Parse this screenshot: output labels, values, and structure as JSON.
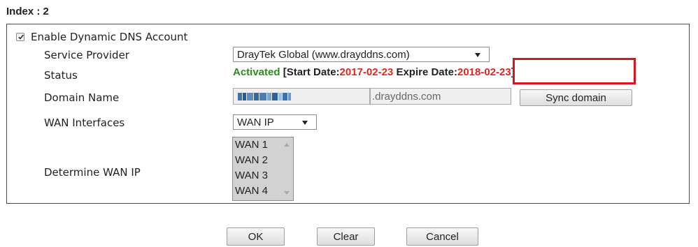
{
  "index_title": "Index : 2",
  "enable": {
    "label": "Enable Dynamic DNS Account",
    "checked": true
  },
  "service_provider": {
    "label": "Service Provider",
    "value": "DrayTek Global (www.drayddns.com)"
  },
  "status": {
    "label": "Status",
    "activated": "Activated",
    "start_prefix": " [Start Date:",
    "start_date": "2017-02-23",
    "expire_prefix": " Expire Date:",
    "expire_date": "2018-02-23",
    "close": "]"
  },
  "domain_name": {
    "label": "Domain Name",
    "suffix_value": ".drayddns.com",
    "sync_button": "Sync domain"
  },
  "wan_interfaces": {
    "label": "WAN Interfaces",
    "value": "WAN IP"
  },
  "determine_wan_ip": {
    "label": "Determine WAN IP",
    "options": [
      "WAN 1",
      "WAN 2",
      "WAN 3",
      "WAN 4"
    ]
  },
  "buttons": {
    "ok": "OK",
    "clear": "Clear",
    "cancel": "Cancel"
  },
  "colors": {
    "activated_green": "#2e8b1e",
    "date_red": "#e1261c",
    "highlight_red": "#d8141e"
  }
}
